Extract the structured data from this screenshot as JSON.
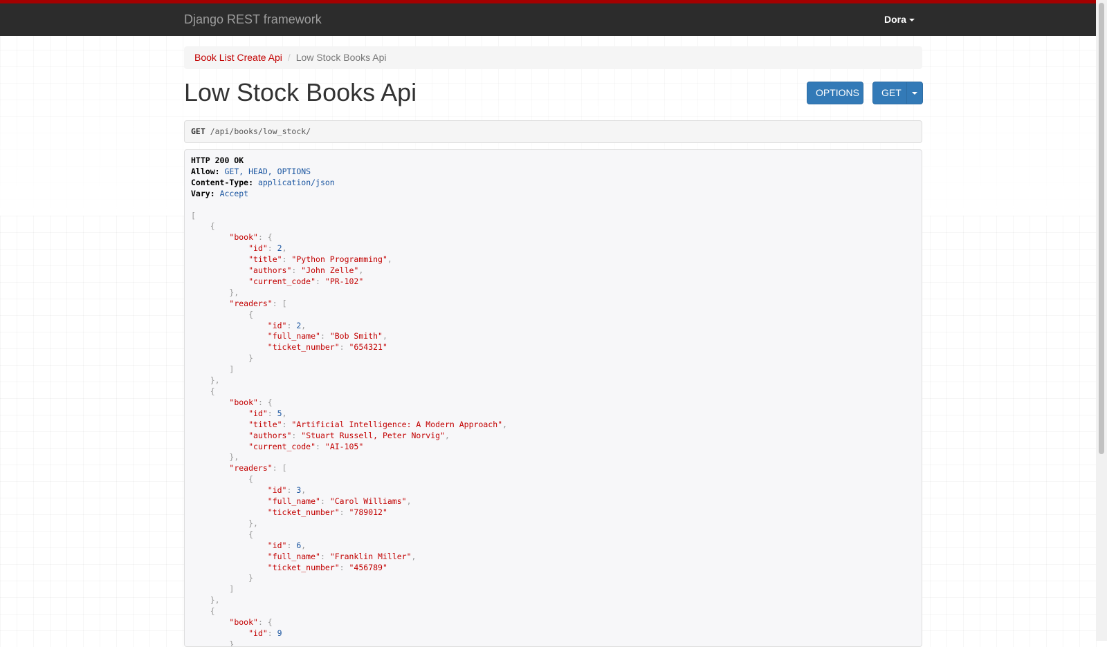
{
  "navbar": {
    "brand": "Django REST framework",
    "user": "Dora"
  },
  "breadcrumb": {
    "parent": "Book List Create Api",
    "current": "Low Stock Books Api"
  },
  "page_title": "Low Stock Books Api",
  "buttons": {
    "options": "OPTIONS",
    "get": "GET"
  },
  "request": {
    "method": "GET",
    "path": "/api/books/low_stock/"
  },
  "response": {
    "status": "HTTP 200 OK",
    "headers": [
      {
        "name": "Allow:",
        "value": "GET, HEAD, OPTIONS"
      },
      {
        "name": "Content-Type:",
        "value": "application/json"
      },
      {
        "name": "Vary:",
        "value": "Accept"
      }
    ],
    "body": [
      {
        "book": {
          "id": 2,
          "title": "Python Programming",
          "authors": "John Zelle",
          "current_code": "PR-102"
        },
        "readers": [
          {
            "id": 2,
            "full_name": "Bob Smith",
            "ticket_number": "654321"
          }
        ]
      },
      {
        "book": {
          "id": 5,
          "title": "Artificial Intelligence: A Modern Approach",
          "authors": "Stuart Russell, Peter Norvig",
          "current_code": "AI-105"
        },
        "readers": [
          {
            "id": 3,
            "full_name": "Carol Williams",
            "ticket_number": "789012"
          },
          {
            "id": 6,
            "full_name": "Franklin Miller",
            "ticket_number": "456789"
          }
        ]
      },
      {
        "book": {
          "id": 9
        }
      }
    ]
  }
}
